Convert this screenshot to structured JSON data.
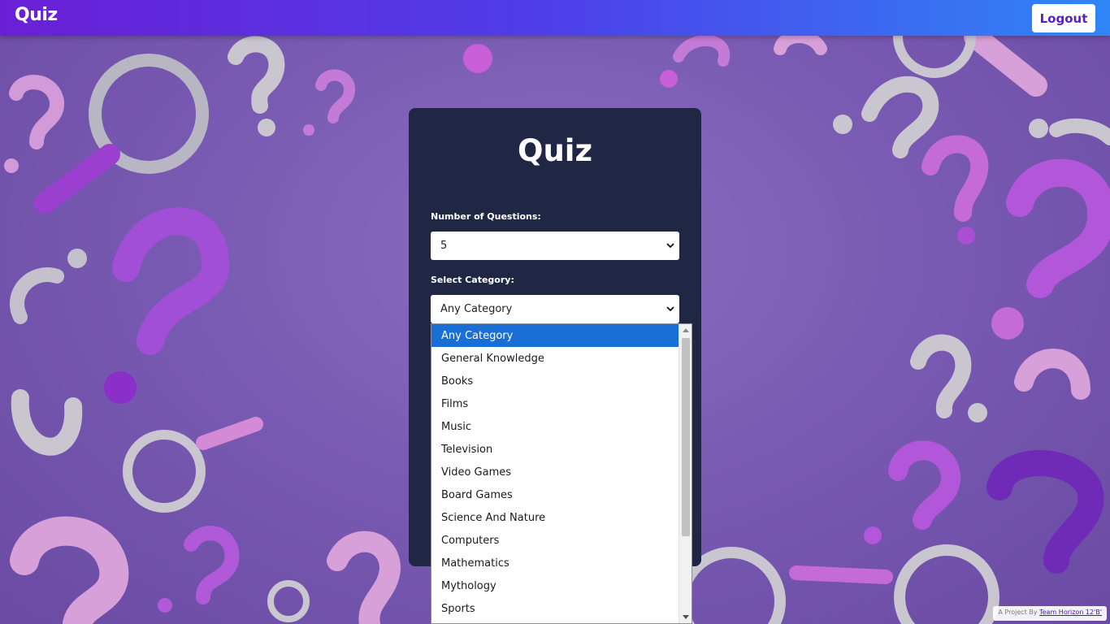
{
  "header": {
    "brand": "Quiz",
    "logout_label": "Logout"
  },
  "card": {
    "title": "Quiz",
    "questions_label": "Number of Questions:",
    "questions_value": "5",
    "category_label": "Select Category:",
    "category_value": "Any Category"
  },
  "dropdown": {
    "options": [
      "Any Category",
      "General Knowledge",
      "Books",
      "Films",
      "Music",
      "Television",
      "Video Games",
      "Board Games",
      "Science And Nature",
      "Computers",
      "Mathematics",
      "Mythology",
      "Sports"
    ],
    "selected_index": 0
  },
  "footer": {
    "credit_prefix": "A Project By",
    "credit_link": "Team Horizon 12'B'"
  },
  "colors": {
    "header_gradient_start": "#6a1fd6",
    "header_gradient_end": "#2f86f7",
    "card_background": "#1f2744",
    "selected_option": "#1a6fd6",
    "background": "#7a5bb3"
  }
}
